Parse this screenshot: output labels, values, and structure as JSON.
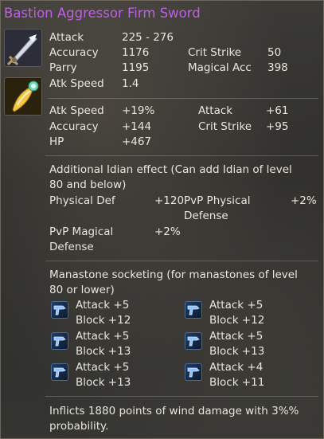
{
  "item": {
    "name": "Bastion Aggressor Firm Sword"
  },
  "icons": {
    "weapon": "sword-icon",
    "idian": "idian-icon",
    "manastone": "manastone-icon"
  },
  "base_stats": [
    {
      "label": "Attack",
      "value": "225 - 276"
    },
    {
      "label": "Accuracy",
      "value": "1176"
    },
    {
      "label": "Crit Strike",
      "value": "50"
    },
    {
      "label": "Parry",
      "value": "1195"
    },
    {
      "label": "Magical Acc",
      "value": "398"
    },
    {
      "label": "Atk Speed",
      "value": "1.4"
    }
  ],
  "bonus_stats": [
    {
      "label": "Atk Speed",
      "value": "+19%"
    },
    {
      "label": "Attack",
      "value": "+61"
    },
    {
      "label": "Accuracy",
      "value": "+144"
    },
    {
      "label": "Crit Strike",
      "value": "+95"
    },
    {
      "label": "HP",
      "value": "+467"
    }
  ],
  "idian": {
    "header_line1": "Additional Idian effect (Can add Idian of level",
    "header_line2": "80 and below)",
    "stats": [
      {
        "label": "Physical Def",
        "value": "+120"
      },
      {
        "label_line1": "PvP Physical",
        "label_line2": "Defense",
        "value": "+2%"
      },
      {
        "label_line1": "PvP Magical",
        "label_line2": "Defense",
        "value": "+2%"
      }
    ]
  },
  "manastone": {
    "header_line1": "Manastone socketing (for manastones of level",
    "header_line2": "80 or lower)",
    "slots": [
      {
        "line1": "Attack +5",
        "line2": "Block +12"
      },
      {
        "line1": "Attack +5",
        "line2": "Block +12"
      },
      {
        "line1": "Attack +5",
        "line2": "Block +13"
      },
      {
        "line1": "Attack +5",
        "line2": "Block +13"
      },
      {
        "line1": "Attack +5",
        "line2": "Block +13"
      },
      {
        "line1": "Attack +4",
        "line2": "Block +11"
      }
    ]
  },
  "effect": {
    "line1": "Inflicts 1880 points of wind damage with 3%%",
    "line2": "probability."
  }
}
